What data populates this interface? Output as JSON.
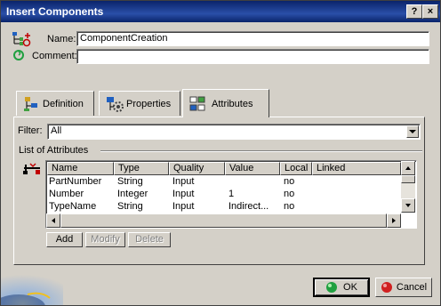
{
  "window": {
    "title": "Insert Components",
    "help_label": "?",
    "close_label": "×"
  },
  "form": {
    "name_label": "Name:",
    "name_value": "ComponentCreation",
    "comment_label": "Comment:",
    "comment_value": ""
  },
  "tabs": [
    {
      "label": "Definition",
      "icon": "definition-icon"
    },
    {
      "label": "Properties",
      "icon": "properties-icon"
    },
    {
      "label": "Attributes",
      "icon": "attributes-icon",
      "active": true
    }
  ],
  "filter": {
    "label": "Filter:",
    "value": "All"
  },
  "attributes": {
    "group_label": "List of Attributes",
    "columns": [
      "Name",
      "Type",
      "Quality",
      "Value",
      "Local",
      "Linked"
    ],
    "rows": [
      [
        "PartNumber",
        "String",
        "Input",
        "",
        "no",
        ""
      ],
      [
        "Number",
        "Integer",
        "Input",
        "1",
        "no",
        ""
      ],
      [
        "TypeName",
        "String",
        "Input",
        "Indirect...",
        "no",
        ""
      ]
    ],
    "buttons": {
      "add": "Add",
      "modify": "Modify",
      "delete": "Delete"
    }
  },
  "footer": {
    "ok_label": "OK",
    "cancel_label": "Cancel"
  }
}
